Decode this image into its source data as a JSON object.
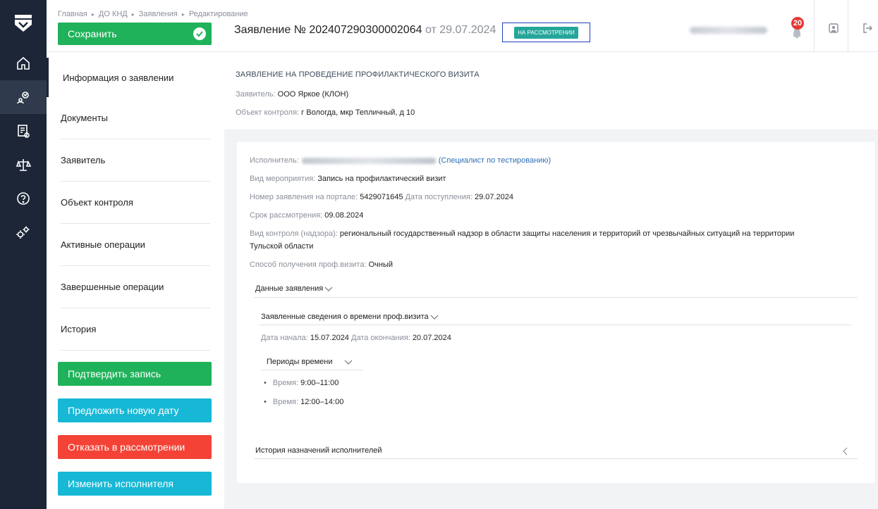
{
  "header": {
    "breadcrumb": [
      "Главная",
      "ДО КНД",
      "Заявления",
      "Редактирование"
    ],
    "save_label": "Сохранить",
    "title_prefix": "Заявление",
    "title_number": "№ 202407290300002064",
    "title_date": "от 29.07.2024",
    "status": "НА РАССМОТРЕНИИ",
    "notifications_count": "20"
  },
  "rail": {
    "items": [
      "home-icon",
      "applications-icon",
      "documents-icon",
      "scales-icon",
      "help-icon",
      "settings-icon"
    ]
  },
  "nav": {
    "items": [
      {
        "label": "Информация о заявлении"
      },
      {
        "label": "Документы"
      },
      {
        "label": "Заявитель"
      },
      {
        "label": "Объект контроля"
      },
      {
        "label": "Активные операции"
      },
      {
        "label": "Завершенные операции"
      },
      {
        "label": "История"
      }
    ]
  },
  "actions": {
    "confirm": "Подтвердить запись",
    "propose_date": "Предложить новую дату",
    "reject": "Отказать в рассмотрении",
    "change_executor": "Изменить исполнителя"
  },
  "summary": {
    "title": "ЗАЯВЛЕНИЕ НА ПРОВЕДЕНИЕ ПРОФИЛАКТИЧЕСКОГО ВИЗИТА",
    "applicant_label": "Заявитель:",
    "applicant_value": "ООО Яркое (КЛОН)",
    "object_label": "Объект контроля:",
    "object_value": "г Вологда, мкр Тепличный, д 10"
  },
  "details": {
    "executor_label": "Исполнитель:",
    "executor_role": "(Специалист по тестированию)",
    "event_label": "Вид мероприятия:",
    "event_value": "Запись на профилактический визит",
    "portal_number_label": "Номер заявления на портале:",
    "portal_number_value": "5429071645",
    "received_label": "Дата поступления:",
    "received_value": "29.07.2024",
    "deadline_label": "Срок рассмотрения:",
    "deadline_value": "09.08.2024",
    "control_type_label": "Вид контроля (надзора):",
    "control_type_value_1": "региональный государственный надзор в области защиты населения и территорий от чрезвычайных ситуаций на территории",
    "control_type_value_2": "Тульской области",
    "method_label": "Способ получения проф.визита:",
    "method_value": "Очный",
    "app_data_head": "Данные заявления",
    "declared_time_head": "Заявленные сведения о времени проф.визита",
    "start_label": "Дата начала:",
    "start_value": "15.07.2024",
    "end_label": "Дата окончания:",
    "end_value": "20.07.2024",
    "periods_head": "Периоды времени",
    "time_label": "Время:",
    "periods": [
      "9:00–11:00",
      "12:00–14:00"
    ],
    "history_head": "История назначений исполнителей"
  },
  "colors": {
    "rail": "#1c2637",
    "save_green": "#20b25a",
    "status_teal": "#26a69a",
    "propose_cyan": "#17b8d6",
    "reject_red": "#f44336",
    "link_blue": "#2f6fb5"
  }
}
